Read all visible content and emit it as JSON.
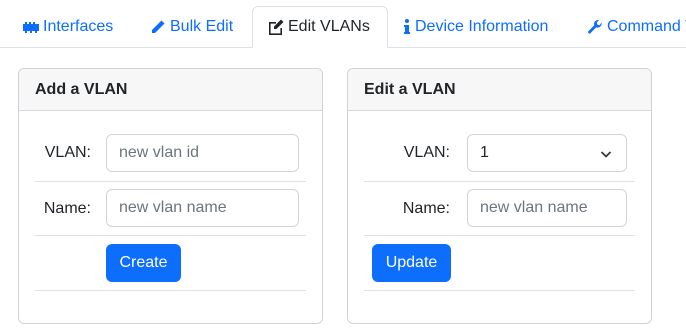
{
  "tabs": [
    {
      "label": "Interfaces",
      "icon": "network-icon"
    },
    {
      "label": "Bulk Edit",
      "icon": "pencil-icon"
    },
    {
      "label": "Edit VLANs",
      "icon": "edit-square-icon",
      "active": true
    },
    {
      "label": "Device Information",
      "icon": "info-icon"
    },
    {
      "label": "Command T",
      "icon": "wrench-icon"
    }
  ],
  "add_vlan": {
    "title": "Add a VLAN",
    "vlan_label": "VLAN:",
    "vlan_placeholder": "new vlan id",
    "name_label": "Name:",
    "name_placeholder": "new vlan name",
    "create_label": "Create"
  },
  "edit_vlan": {
    "title": "Edit a VLAN",
    "vlan_label": "VLAN:",
    "vlan_selected": "1",
    "name_label": "Name:",
    "name_placeholder": "new vlan name",
    "update_label": "Update"
  },
  "colors": {
    "accent": "#0d6efd",
    "header_bg": "#f7f7f7",
    "border": "#dee2e6"
  }
}
